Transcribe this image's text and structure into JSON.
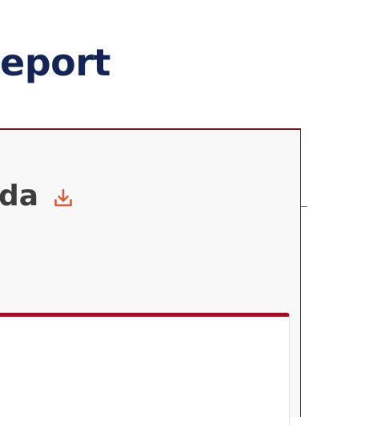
{
  "page": {
    "title": "eport"
  },
  "panel": {
    "heading": "da",
    "download_icon": "download-icon"
  },
  "colors": {
    "title": "#142454",
    "panel_border_top": "#6e1c27",
    "panel_background": "#f8f8f8",
    "heading_text": "#3d3d3d",
    "download_icon": "#d4603a",
    "inner_card_accent": "#9c1122"
  }
}
